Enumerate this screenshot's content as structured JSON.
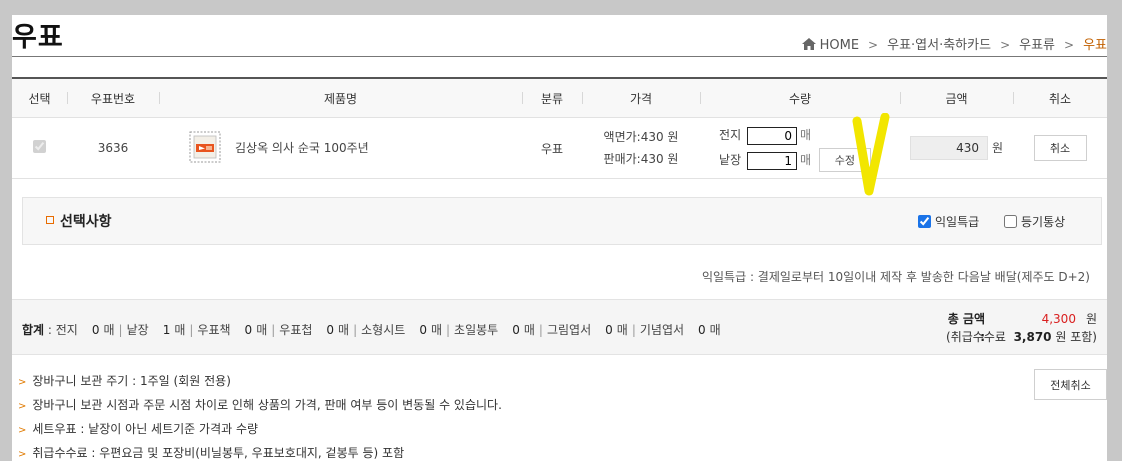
{
  "page": {
    "title": "우표",
    "breadcrumb": [
      "HOME",
      "우표·엽서·축하카드",
      "우표류",
      "우표"
    ]
  },
  "table": {
    "headers": [
      "선택",
      "우표번호",
      "제품명",
      "분류",
      "가격",
      "수량",
      "금액",
      "취소"
    ],
    "row": {
      "selected": true,
      "stamp_no": "3636",
      "product_name": "김상옥 의사 순국 100주년",
      "category": "우표",
      "face_price": "액면가:430 원",
      "sale_price": "판매가:430 원",
      "qty_sheet_label": "전지",
      "qty_sheet_value": "0",
      "qty_single_label": "낱장",
      "qty_single_value": "1",
      "qty_unit": "매",
      "edit_label": "수정",
      "amount": "430",
      "amount_unit": "원",
      "cancel_label": "취소"
    }
  },
  "options": {
    "title": "선택사항",
    "express_label": "익일특급",
    "express_checked": true,
    "registered_label": "등기통상",
    "registered_checked": false,
    "express_note": "익일특급 : 결제일로부터 10일이내 제작 후 발송한 다음날 배달(제주도 D+2)"
  },
  "totals": {
    "label": "합계",
    "items": [
      {
        "name": "전지",
        "count": "0",
        "unit": "매"
      },
      {
        "name": "낱장",
        "count": "1",
        "unit": "매"
      },
      {
        "name": "우표책",
        "count": "0",
        "unit": "매"
      },
      {
        "name": "우표첩",
        "count": "0",
        "unit": "매"
      },
      {
        "name": "소형시트",
        "count": "0",
        "unit": "매"
      },
      {
        "name": "초일봉투",
        "count": "0",
        "unit": "매"
      },
      {
        "name": "그림엽서",
        "count": "0",
        "unit": "매"
      },
      {
        "name": "기념엽서",
        "count": "0",
        "unit": "매"
      }
    ],
    "grand_label": "총 금액 :",
    "grand_value": "4,300",
    "grand_unit": "원",
    "fee_prefix": "(취급수수료",
    "fee_value": "3,870",
    "fee_suffix": "원 포함)"
  },
  "notes": [
    "장바구니 보관 주기 : 1주일 (회원 전용)",
    "장바구니 보관 시점과 주문 시점 차이로 인해 상품의 가격, 판매 여부 등이 변동될 수 있습니다.",
    "세트우표 : 낱장이 아닌 세트기준 가격과 수량",
    "취급수수료 : 우편요금 및 포장비(비닐봉투, 우표보호대지, 겉봉투 등) 포함"
  ],
  "cancel_all_label": "전체취소",
  "colors": {
    "accent_orange": "#e86c00",
    "grand_red": "#d92020",
    "annotation_yellow": "#f2e600"
  },
  "icons": [
    "home-icon",
    "stamp-thumbnail",
    "yellow-check-annotation"
  ]
}
